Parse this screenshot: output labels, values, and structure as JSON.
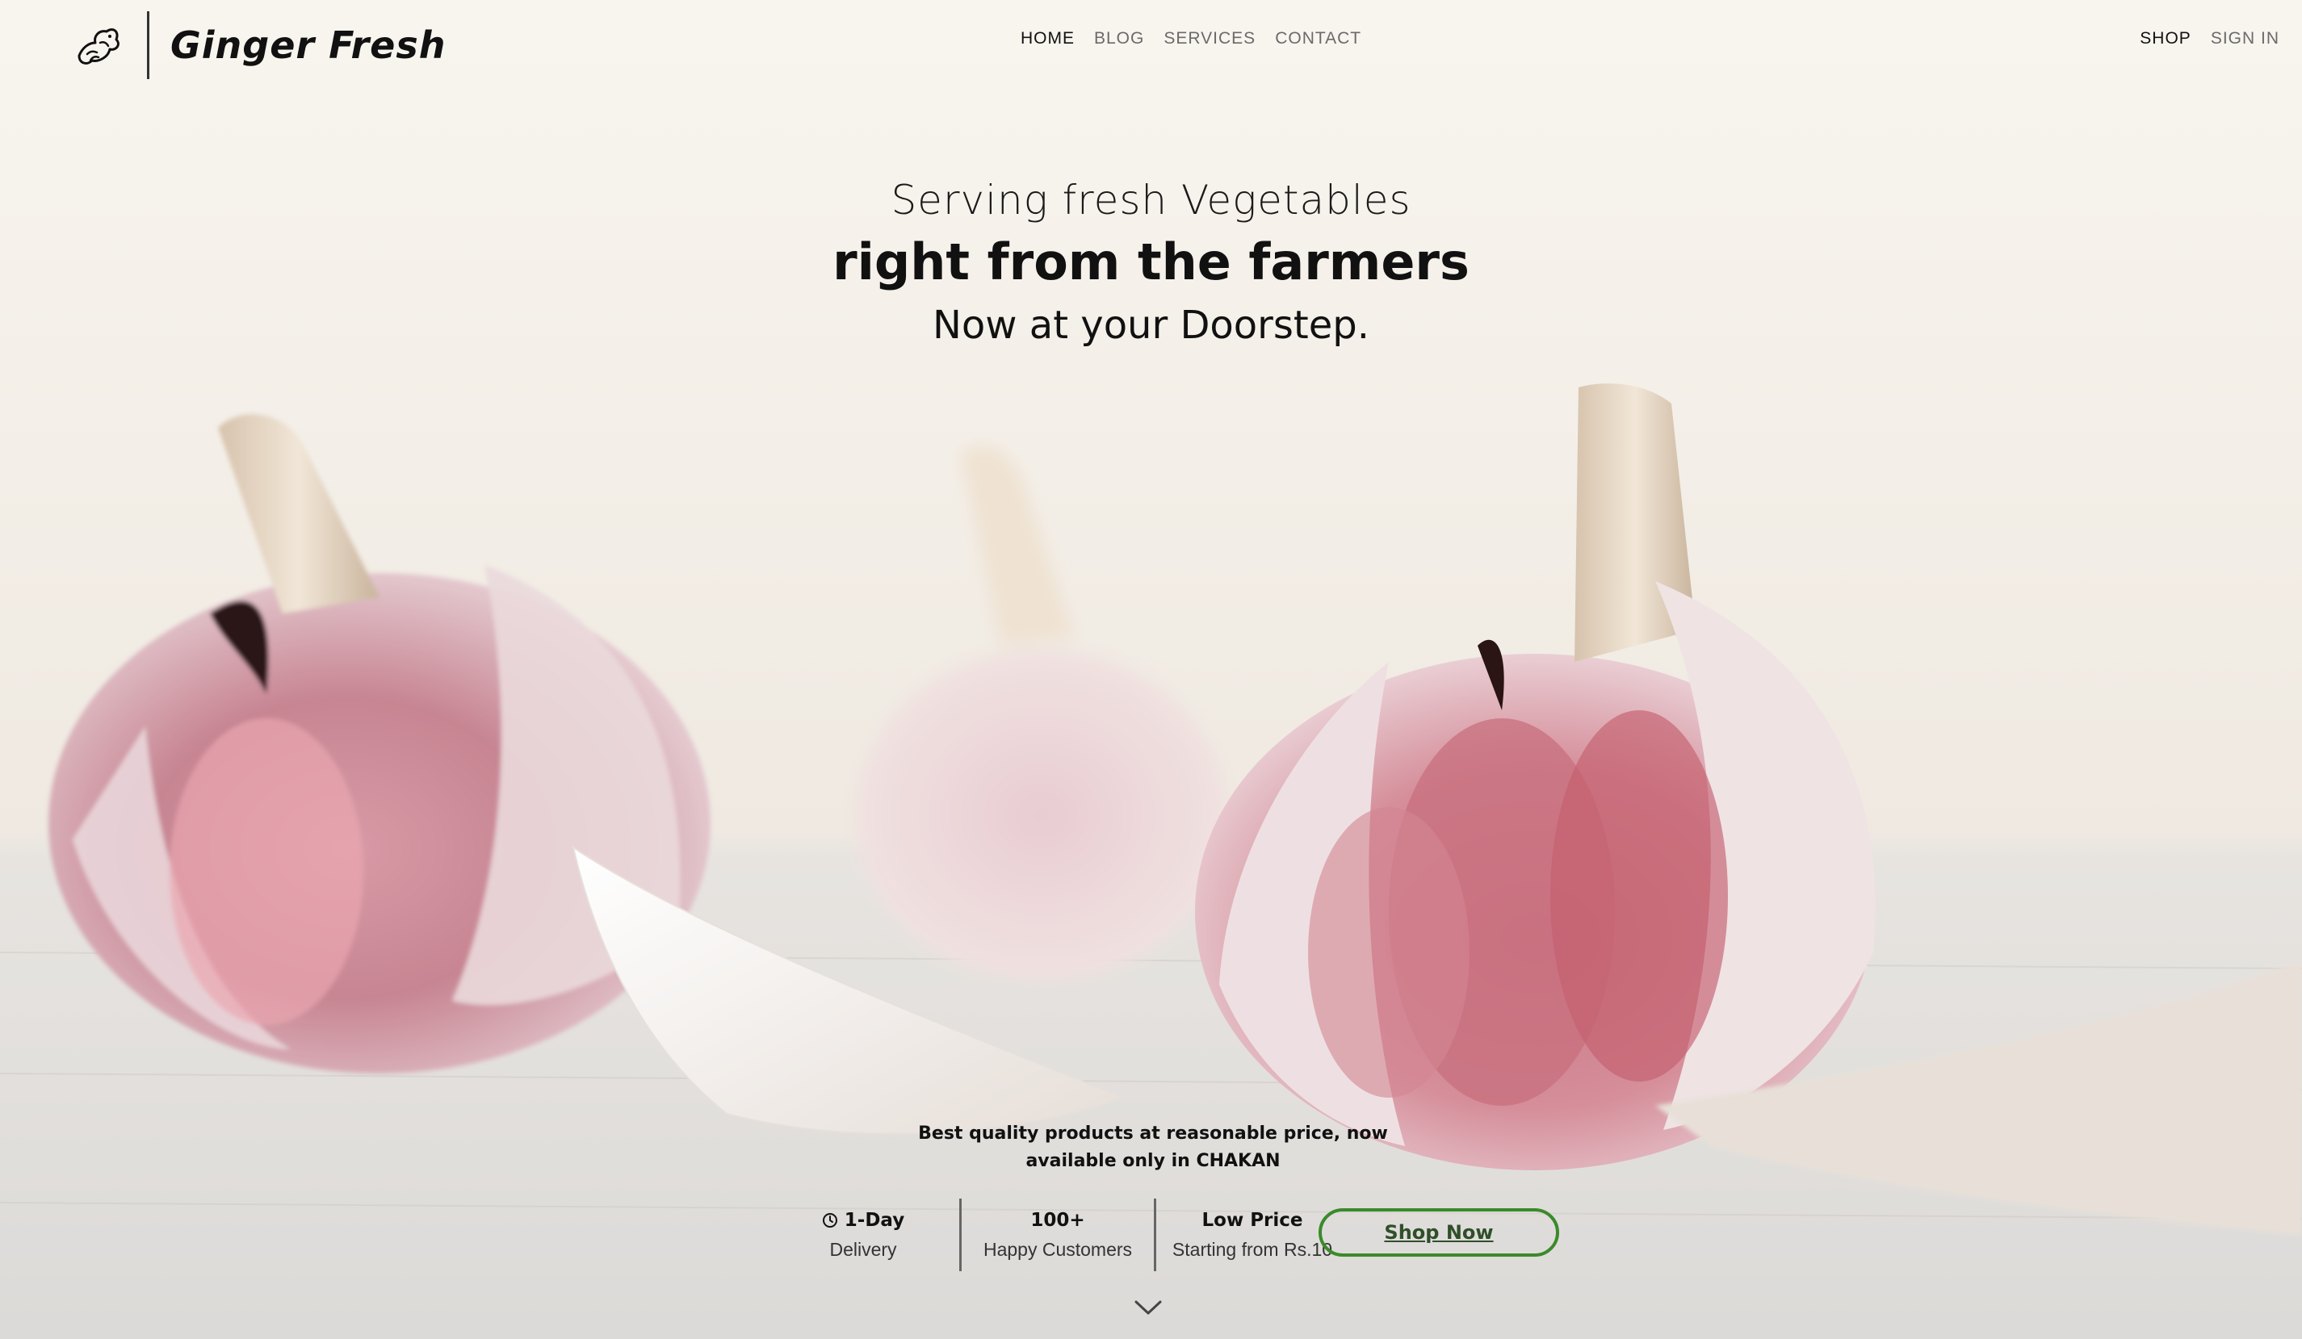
{
  "brand": {
    "name": "Ginger Fresh",
    "logo_icon": "ginger-icon"
  },
  "nav": {
    "items": [
      {
        "label": "HOME",
        "active": true
      },
      {
        "label": "BLOG",
        "active": false
      },
      {
        "label": "SERVICES",
        "active": false
      },
      {
        "label": "CONTACT",
        "active": false
      }
    ],
    "right": [
      {
        "label": "SHOP",
        "active": true
      },
      {
        "label": "SIGN IN",
        "active": false
      }
    ]
  },
  "hero": {
    "line1": "Serving fresh Vegetables",
    "line2": "right from the farmers",
    "line3": "Now at your Doorstep.",
    "background": "garlic bulbs photo"
  },
  "tagline": "Best quality products at reasonable price, now available only in CHAKAN",
  "stats": [
    {
      "title": "1-Day",
      "sub": "Delivery",
      "icon": "clock-icon"
    },
    {
      "title": "100+",
      "sub": "Happy Customers"
    },
    {
      "title": "Low Price",
      "sub": "Starting from Rs.10"
    }
  ],
  "cta": {
    "label": "Shop Now",
    "border_color": "#3a8a2a"
  },
  "scroll_icon": "chevron-down-icon"
}
